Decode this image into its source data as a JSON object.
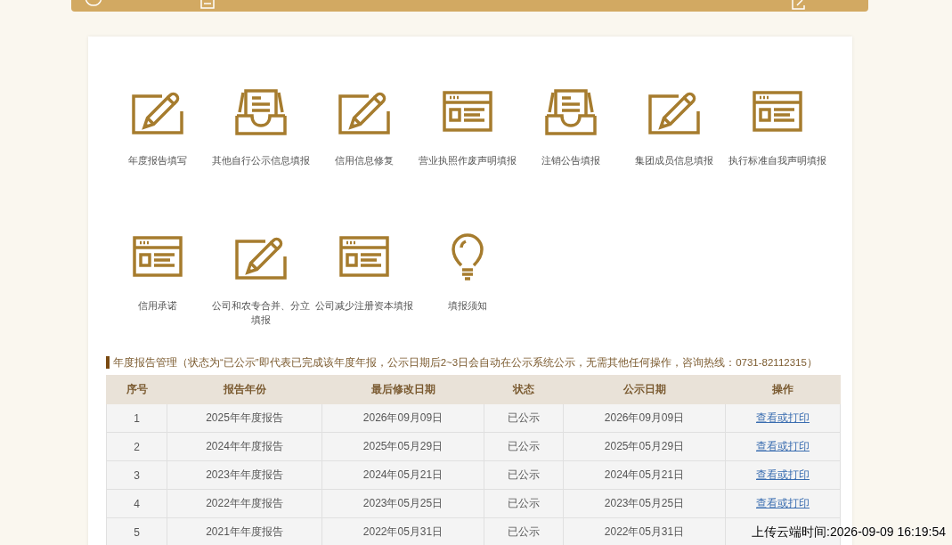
{
  "services": [
    {
      "label": "年度报告填写",
      "kind": "pencil"
    },
    {
      "label": "其他自行公示信息填报",
      "kind": "tray"
    },
    {
      "label": "信用信息修复",
      "kind": "pencil"
    },
    {
      "label": "营业执照作废声明填报",
      "kind": "window"
    },
    {
      "label": "注销公告填报",
      "kind": "tray"
    },
    {
      "label": "集团成员信息填报",
      "kind": "pencil"
    },
    {
      "label": "执行标准自我声明填报",
      "kind": "window"
    },
    {
      "label": "信用承诺",
      "kind": "window"
    },
    {
      "label": "公司和农专合并、分立填报",
      "kind": "pencil"
    },
    {
      "label": "公司减少注册资本填报",
      "kind": "window"
    },
    {
      "label": "填报须知",
      "kind": "bulb"
    }
  ],
  "annual_reports": {
    "heading": "年度报告管理（状态为“已公示”即代表已完成该年度年报，公示日期后2~3日会自动在公示系统公示，无需其他任何操作，咨询热线：0731-82112315）",
    "columns": [
      "序号",
      "报告年份",
      "最后修改日期",
      "状态",
      "公示日期",
      "操作"
    ],
    "rows": [
      {
        "cells": [
          "1",
          "2025年年度报告",
          "2026年09月09日",
          "已公示",
          "2026年09月09日"
        ],
        "action": "查看或打印"
      },
      {
        "cells": [
          "2",
          "2024年年度报告",
          "2025年05月29日",
          "已公示",
          "2025年05月29日"
        ],
        "action": "查看或打印"
      },
      {
        "cells": [
          "3",
          "2023年年度报告",
          "2024年05月21日",
          "已公示",
          "2024年05月21日"
        ],
        "action": "查看或打印"
      },
      {
        "cells": [
          "4",
          "2022年年度报告",
          "2023年05月25日",
          "已公示",
          "2023年05月25日"
        ],
        "action": "查看或打印"
      },
      {
        "cells": [
          "5",
          "2021年年度报告",
          "2022年05月31日",
          "已公示",
          "2022年05月31日"
        ]
      }
    ]
  },
  "upload_time": "上传云端时间:2026-09-09 16:19:54"
}
